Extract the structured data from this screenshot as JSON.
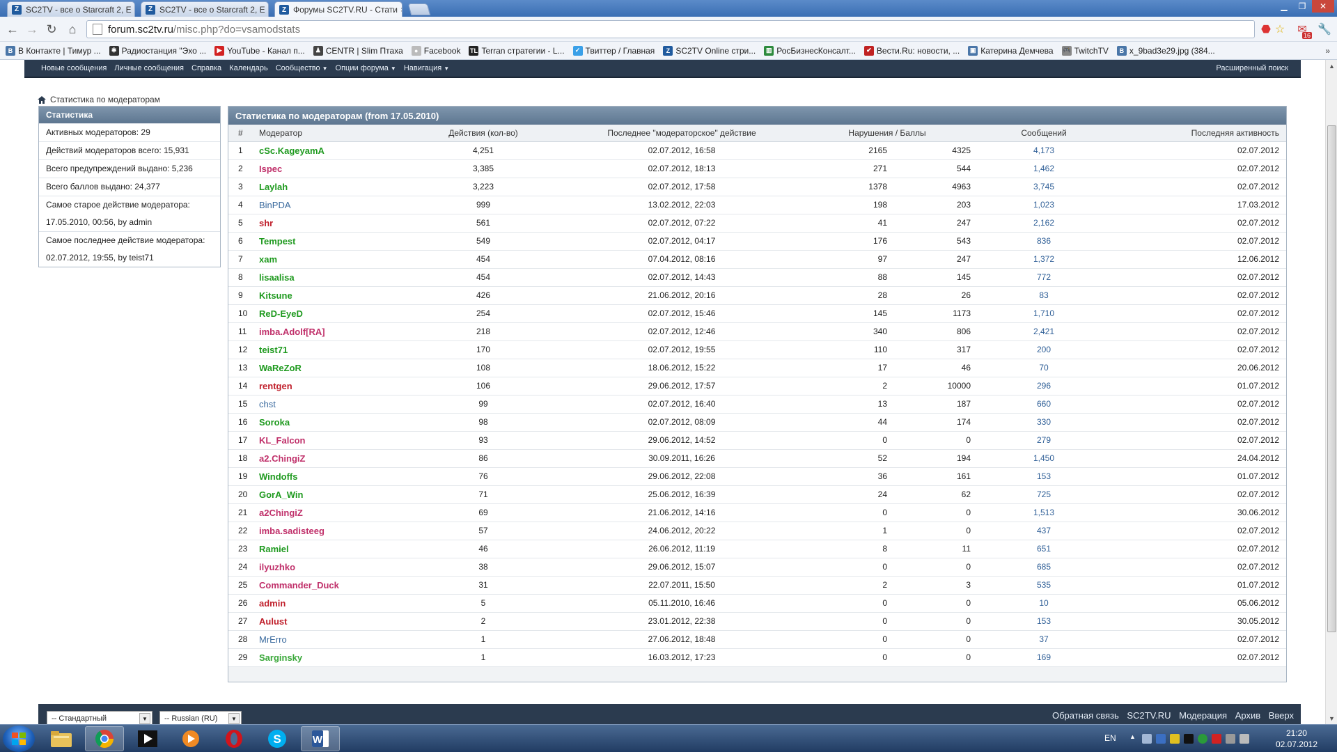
{
  "browser": {
    "tabs": [
      {
        "title": "SC2TV - все о Starcraft 2, E"
      },
      {
        "title": "SC2TV - все о Starcraft 2, E"
      },
      {
        "title": "Форумы SC2TV.RU - Стати"
      }
    ],
    "url_host": "forum.sc2tv.ru",
    "url_path": "/misc.php?do=vsamodstats",
    "gmail_badge": "16",
    "bookmarks": [
      {
        "label": "В Контакте | Тимур ...",
        "color": "#4a76a8",
        "glyph": "В"
      },
      {
        "label": "Радиостанция \"Эхо ...",
        "color": "#333333",
        "glyph": "✱"
      },
      {
        "label": "YouTube - Канал п...",
        "color": "#d22222",
        "glyph": "▶"
      },
      {
        "label": "CENTR | Slim Птаха",
        "color": "#444444",
        "glyph": "♟"
      },
      {
        "label": "Facebook",
        "color": "#bbbbbb",
        "glyph": "●"
      },
      {
        "label": "Terran стратегии - L...",
        "color": "#222222",
        "glyph": "TL"
      },
      {
        "label": "Твиттер / Главная",
        "color": "#3aa0e8",
        "glyph": "✓"
      },
      {
        "label": "SC2TV Online стри...",
        "color": "#1f5a9e",
        "glyph": "Z"
      },
      {
        "label": "РосБизнесКонсалт...",
        "color": "#2e8b3e",
        "glyph": "▥"
      },
      {
        "label": "Вести.Ru: новости, ...",
        "color": "#c02222",
        "glyph": "✔"
      },
      {
        "label": "Катерина Демчева",
        "color": "#4a76a8",
        "glyph": "▣"
      },
      {
        "label": "TwitchTV",
        "color": "#888888",
        "glyph": "🎮"
      },
      {
        "label": "x_9bad3e29.jpg (384...",
        "color": "#4a76a8",
        "glyph": "В"
      }
    ],
    "bookmarks_more": "»"
  },
  "forum": {
    "nav": {
      "items": [
        {
          "label": "Новые сообщения",
          "caret": false
        },
        {
          "label": "Личные сообщения",
          "caret": false
        },
        {
          "label": "Справка",
          "caret": false
        },
        {
          "label": "Календарь",
          "caret": false
        },
        {
          "label": "Сообщество",
          "caret": true
        },
        {
          "label": "Опции форума",
          "caret": true
        },
        {
          "label": "Навигация",
          "caret": true
        }
      ],
      "advanced_search": "Расширенный поиск"
    },
    "breadcrumb": "Статистика по модераторам",
    "stats": {
      "title": "Статистика",
      "rows": [
        "Активных модераторов: 29",
        "Действий модераторов всего: 15,931",
        "Всего предупреждений выдано: 5,236",
        "Всего баллов выдано: 24,377",
        "Самое старое действие модератора:",
        "17.05.2010, 00:56, by admin",
        "Самое последнее действие модератора:",
        "02.07.2012, 19:55, by teist71"
      ]
    },
    "table": {
      "title": "Статистика по модераторам (from 17.05.2010)",
      "headers": {
        "num": "#",
        "moderator": "Модератор",
        "actions": "Действия (кол-во)",
        "last_action": "Последнее \"модераторское\" действие",
        "warnings_points": "Нарушения / Баллы",
        "posts": "Сообщений",
        "last_activity": "Последняя активность"
      },
      "colors": {
        "green": "#1f9a1f",
        "red": "#c0202c",
        "pink": "#c0306a",
        "blue": "#3a6a9e",
        "lightgreen": "#3aa83a"
      },
      "rows": [
        {
          "n": "1",
          "name": "cSc.KageyamA",
          "color": "green",
          "bold": true,
          "actions": "4,251",
          "last": "02.07.2012, 16:58",
          "warn": "2165",
          "pts": "4325",
          "posts": "4,173",
          "seen": "02.07.2012"
        },
        {
          "n": "2",
          "name": "Ispec",
          "color": "pink",
          "bold": true,
          "actions": "3,385",
          "last": "02.07.2012, 18:13",
          "warn": "271",
          "pts": "544",
          "posts": "1,462",
          "seen": "02.07.2012"
        },
        {
          "n": "3",
          "name": "Laylah",
          "color": "green",
          "bold": true,
          "actions": "3,223",
          "last": "02.07.2012, 17:58",
          "warn": "1378",
          "pts": "4963",
          "posts": "3,745",
          "seen": "02.07.2012"
        },
        {
          "n": "4",
          "name": "BinPDA",
          "color": "blue",
          "bold": false,
          "actions": "999",
          "last": "13.02.2012, 22:03",
          "warn": "198",
          "pts": "203",
          "posts": "1,023",
          "seen": "17.03.2012"
        },
        {
          "n": "5",
          "name": "shr",
          "color": "red",
          "bold": true,
          "actions": "561",
          "last": "02.07.2012, 07:22",
          "warn": "41",
          "pts": "247",
          "posts": "2,162",
          "seen": "02.07.2012"
        },
        {
          "n": "6",
          "name": "Tempest",
          "color": "green",
          "bold": true,
          "actions": "549",
          "last": "02.07.2012, 04:17",
          "warn": "176",
          "pts": "543",
          "posts": "836",
          "seen": "02.07.2012"
        },
        {
          "n": "7",
          "name": "xam",
          "color": "green",
          "bold": true,
          "actions": "454",
          "last": "07.04.2012, 08:16",
          "warn": "97",
          "pts": "247",
          "posts": "1,372",
          "seen": "12.06.2012"
        },
        {
          "n": "8",
          "name": "lisaalisa",
          "color": "green",
          "bold": true,
          "actions": "454",
          "last": "02.07.2012, 14:43",
          "warn": "88",
          "pts": "145",
          "posts": "772",
          "seen": "02.07.2012"
        },
        {
          "n": "9",
          "name": "Kitsune",
          "color": "green",
          "bold": true,
          "actions": "426",
          "last": "21.06.2012, 20:16",
          "warn": "28",
          "pts": "26",
          "posts": "83",
          "seen": "02.07.2012"
        },
        {
          "n": "10",
          "name": "ReD-EyeD",
          "color": "green",
          "bold": true,
          "actions": "254",
          "last": "02.07.2012, 15:46",
          "warn": "145",
          "pts": "1173",
          "posts": "1,710",
          "seen": "02.07.2012"
        },
        {
          "n": "11",
          "name": "imba.Adolf[RA]",
          "color": "pink",
          "bold": true,
          "actions": "218",
          "last": "02.07.2012, 12:46",
          "warn": "340",
          "pts": "806",
          "posts": "2,421",
          "seen": "02.07.2012"
        },
        {
          "n": "12",
          "name": "teist71",
          "color": "green",
          "bold": true,
          "actions": "170",
          "last": "02.07.2012, 19:55",
          "warn": "110",
          "pts": "317",
          "posts": "200",
          "seen": "02.07.2012"
        },
        {
          "n": "13",
          "name": "WaReZoR",
          "color": "green",
          "bold": true,
          "actions": "108",
          "last": "18.06.2012, 15:22",
          "warn": "17",
          "pts": "46",
          "posts": "70",
          "seen": "20.06.2012"
        },
        {
          "n": "14",
          "name": "rentgen",
          "color": "red",
          "bold": true,
          "actions": "106",
          "last": "29.06.2012, 17:57",
          "warn": "2",
          "pts": "10000",
          "posts": "296",
          "seen": "01.07.2012"
        },
        {
          "n": "15",
          "name": "chst",
          "color": "blue",
          "bold": false,
          "actions": "99",
          "last": "02.07.2012, 16:40",
          "warn": "13",
          "pts": "187",
          "posts": "660",
          "seen": "02.07.2012"
        },
        {
          "n": "16",
          "name": "Soroka",
          "color": "green",
          "bold": true,
          "actions": "98",
          "last": "02.07.2012, 08:09",
          "warn": "44",
          "pts": "174",
          "posts": "330",
          "seen": "02.07.2012"
        },
        {
          "n": "17",
          "name": "KL_Falcon",
          "color": "pink",
          "bold": true,
          "actions": "93",
          "last": "29.06.2012, 14:52",
          "warn": "0",
          "pts": "0",
          "posts": "279",
          "seen": "02.07.2012"
        },
        {
          "n": "18",
          "name": "a2.ChingiZ",
          "color": "pink",
          "bold": true,
          "actions": "86",
          "last": "30.09.2011, 16:26",
          "warn": "52",
          "pts": "194",
          "posts": "1,450",
          "seen": "24.04.2012"
        },
        {
          "n": "19",
          "name": "Windoffs",
          "color": "green",
          "bold": true,
          "actions": "76",
          "last": "29.06.2012, 22:08",
          "warn": "36",
          "pts": "161",
          "posts": "153",
          "seen": "01.07.2012"
        },
        {
          "n": "20",
          "name": "GorA_Win",
          "color": "green",
          "bold": true,
          "actions": "71",
          "last": "25.06.2012, 16:39",
          "warn": "24",
          "pts": "62",
          "posts": "725",
          "seen": "02.07.2012"
        },
        {
          "n": "21",
          "name": "a2ChingiZ",
          "color": "pink",
          "bold": true,
          "actions": "69",
          "last": "21.06.2012, 14:16",
          "warn": "0",
          "pts": "0",
          "posts": "1,513",
          "seen": "30.06.2012"
        },
        {
          "n": "22",
          "name": "imba.sadisteeg",
          "color": "pink",
          "bold": true,
          "actions": "57",
          "last": "24.06.2012, 20:22",
          "warn": "1",
          "pts": "0",
          "posts": "437",
          "seen": "02.07.2012"
        },
        {
          "n": "23",
          "name": "Ramiel",
          "color": "green",
          "bold": true,
          "actions": "46",
          "last": "26.06.2012, 11:19",
          "warn": "8",
          "pts": "11",
          "posts": "651",
          "seen": "02.07.2012"
        },
        {
          "n": "24",
          "name": "ilyuzhko",
          "color": "pink",
          "bold": true,
          "actions": "38",
          "last": "29.06.2012, 15:07",
          "warn": "0",
          "pts": "0",
          "posts": "685",
          "seen": "02.07.2012"
        },
        {
          "n": "25",
          "name": "Commander_Duck",
          "color": "pink",
          "bold": true,
          "actions": "31",
          "last": "22.07.2011, 15:50",
          "warn": "2",
          "pts": "3",
          "posts": "535",
          "seen": "01.07.2012"
        },
        {
          "n": "26",
          "name": "admin",
          "color": "red",
          "bold": true,
          "actions": "5",
          "last": "05.11.2010, 16:46",
          "warn": "0",
          "pts": "0",
          "posts": "10",
          "seen": "05.06.2012"
        },
        {
          "n": "27",
          "name": "Aulust",
          "color": "red",
          "bold": true,
          "actions": "2",
          "last": "23.01.2012, 22:38",
          "warn": "0",
          "pts": "0",
          "posts": "153",
          "seen": "30.05.2012"
        },
        {
          "n": "28",
          "name": "MrErro",
          "color": "blue",
          "bold": false,
          "actions": "1",
          "last": "27.06.2012, 18:48",
          "warn": "0",
          "pts": "0",
          "posts": "37",
          "seen": "02.07.2012"
        },
        {
          "n": "29",
          "name": "Sarginsky",
          "color": "lightgreen",
          "bold": true,
          "actions": "1",
          "last": "16.03.2012, 17:23",
          "warn": "0",
          "pts": "0",
          "posts": "169",
          "seen": "02.07.2012"
        }
      ]
    },
    "footer": {
      "style_select": "-- Стандартный",
      "lang_select": "-- Russian (RU)",
      "links": [
        "Обратная связь",
        "SC2TV.RU",
        "Модерация",
        "Архив",
        "Вверх"
      ]
    }
  },
  "taskbar": {
    "lang": "EN",
    "time": "21:20",
    "date": "02.07.2012"
  }
}
